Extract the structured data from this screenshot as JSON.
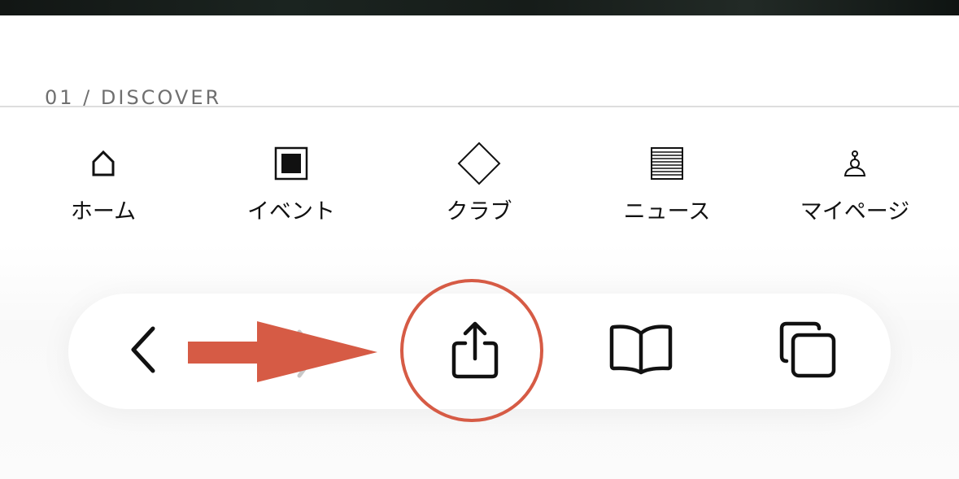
{
  "section": {
    "label": "01 / DISCOVER"
  },
  "tabbar": {
    "items": [
      {
        "label": "ホーム",
        "icon": "home-icon"
      },
      {
        "label": "イベント",
        "icon": "event-icon"
      },
      {
        "label": "クラブ",
        "icon": "club-icon"
      },
      {
        "label": "ニュース",
        "icon": "news-icon"
      },
      {
        "label": "マイページ",
        "icon": "mypage-icon"
      }
    ]
  },
  "toolbar": {
    "buttons": [
      {
        "icon": "back-chevron-icon"
      },
      {
        "icon": "share-icon"
      },
      {
        "icon": "bookmarks-book-icon"
      },
      {
        "icon": "tabs-icon"
      }
    ]
  },
  "annotation": {
    "arrow_color": "#d65b45",
    "ring_color": "#d65b45",
    "target": "share-button"
  },
  "colors": {
    "text": "#111111",
    "muted_label": "#6f6f6f",
    "divider": "#dedede",
    "hero_strip": "#161c19"
  }
}
